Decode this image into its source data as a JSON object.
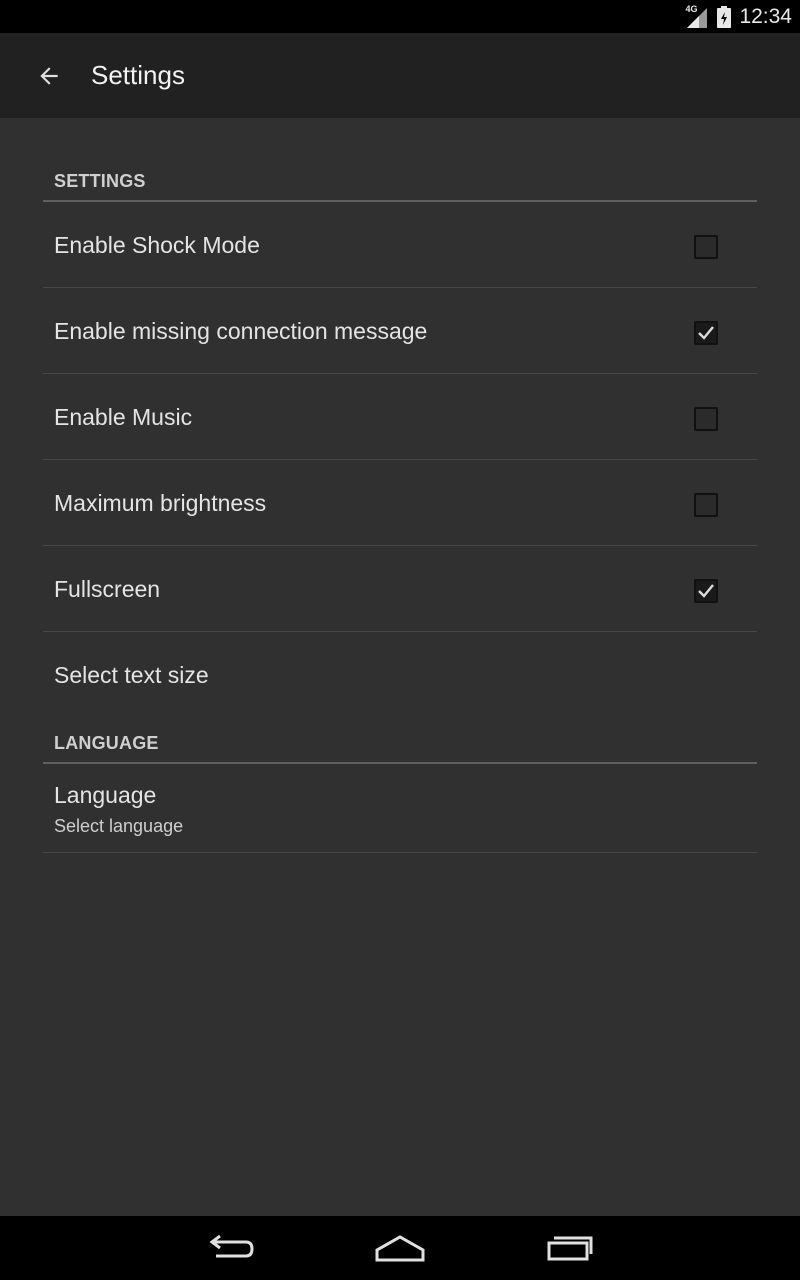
{
  "statusbar": {
    "network_type": "4G",
    "time": "12:34"
  },
  "appbar": {
    "title": "Settings",
    "back_icon": "arrow-back-icon"
  },
  "sections": [
    {
      "header": "SETTINGS",
      "items": [
        {
          "label": "Enable Shock Mode",
          "checked": false
        },
        {
          "label": "Enable missing connection message",
          "checked": true
        },
        {
          "label": "Enable Music",
          "checked": false
        },
        {
          "label": "Maximum brightness",
          "checked": false
        },
        {
          "label": "Fullscreen",
          "checked": true
        },
        {
          "label": "Select text size"
        }
      ]
    },
    {
      "header": "LANGUAGE",
      "items": [
        {
          "title": "Language",
          "subtitle": "Select language"
        }
      ]
    }
  ],
  "navbar": {
    "back_icon": "nav-back-icon",
    "home_icon": "nav-home-icon",
    "recents_icon": "nav-recents-icon"
  },
  "colors": {
    "background": "#303030",
    "appbar": "#212121",
    "system_bars": "#000000"
  }
}
